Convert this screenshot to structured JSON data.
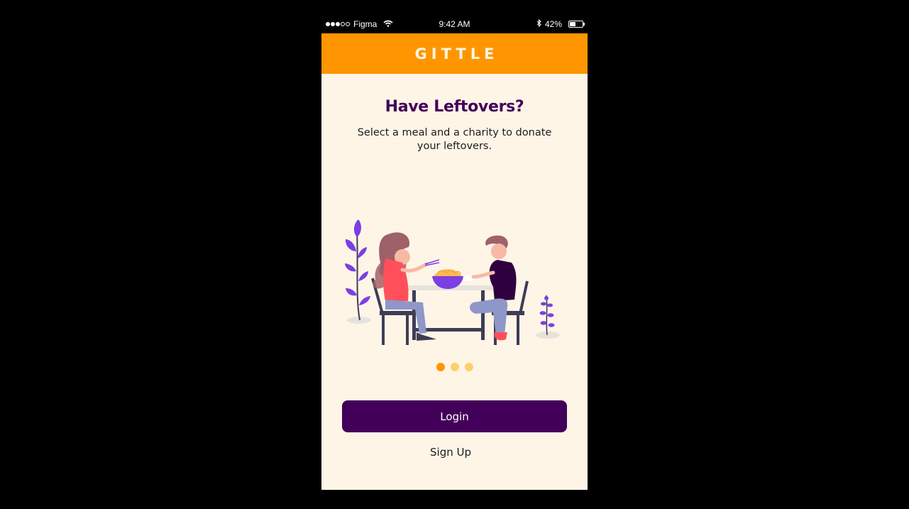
{
  "status_bar": {
    "signal_bars": 3,
    "signal_total": 5,
    "carrier": "Figma",
    "time": "9:42 AM",
    "battery_percent": "42%",
    "battery_level": 0.42,
    "icons": [
      "wifi-icon",
      "bluetooth-icon",
      "battery-icon"
    ]
  },
  "header": {
    "title": "GITTLE"
  },
  "onboarding": {
    "title": "Have Leftovers?",
    "description": "Select a meal and a charity to donate your leftovers.",
    "illustration": "couple-dining-illustration",
    "page_count": 3,
    "active_page": 0
  },
  "actions": {
    "login_label": "Login",
    "signup_label": "Sign Up"
  },
  "colors": {
    "brand_orange": "#ff9500",
    "brand_purple": "#43005a",
    "background": "#fef5e7",
    "accent_violet": "#7b3fe4",
    "pager_inactive": "#ffcf6b"
  }
}
